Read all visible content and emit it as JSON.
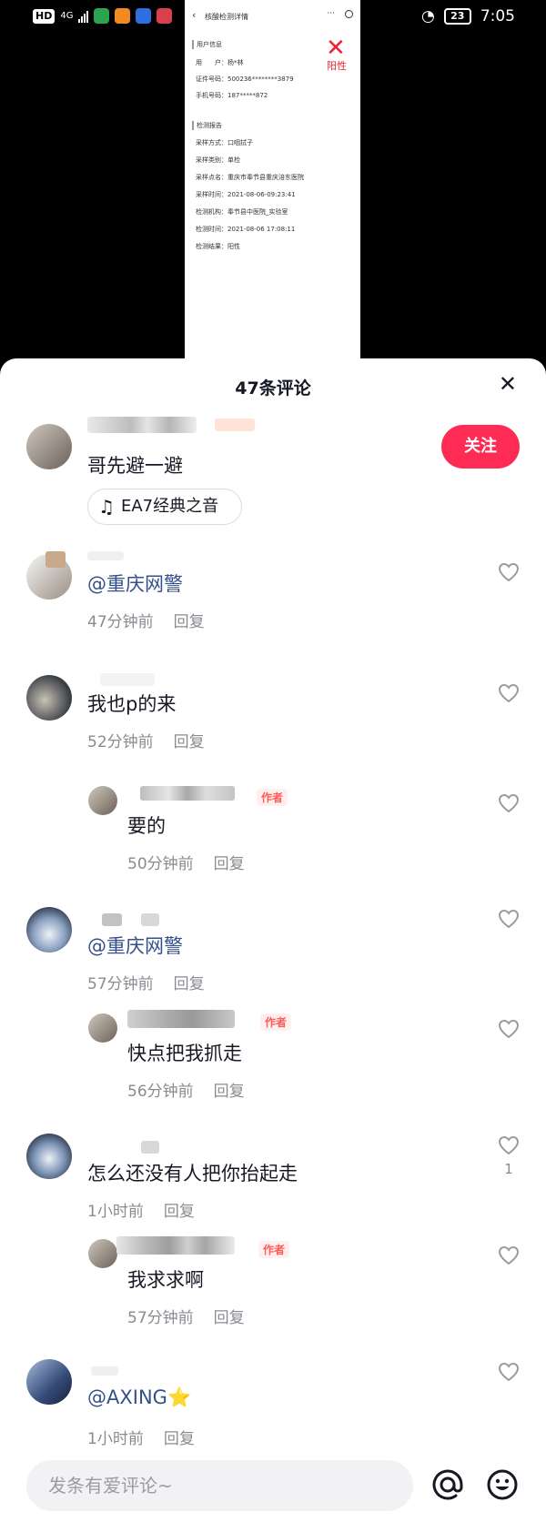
{
  "status_bar": {
    "hd": "HD",
    "network": "4G",
    "time": "7:05",
    "battery": "23"
  },
  "video": {
    "nav_title": "核酸检测详情",
    "nav_more": "···",
    "section_user": "用户信息",
    "rows_user": [
      "用　　户：杨*林",
      "证件号码：500236********3879",
      "手机号码：187*****872"
    ],
    "section_report": "检测报告",
    "rows_report": [
      "采样方式：口咽拭子",
      "采样类别：单检",
      "采样点名：重庆市奉节县重庆涪东医院",
      "采样时间：2021-08-06-09:23:41",
      "检测机构：奉节县中医院_实验室",
      "检测时间：2021-08-06 17:08:11",
      "检测结果：阳性"
    ],
    "result_mark": "✕",
    "result_label": "阳性"
  },
  "panel": {
    "title": "47条评论",
    "close_icon": "close-icon",
    "follow_label": "关注",
    "input_placeholder": "发条有爱评论~",
    "author_badge": "作者",
    "reply_label": "回复"
  },
  "comments": [
    {
      "text": "哥先避一避",
      "music": "EA7经典之音"
    },
    {
      "text": "@重庆网警",
      "time": "47分钟前",
      "reply": "回复"
    },
    {
      "text": "我也p的来",
      "time": "52分钟前",
      "reply": "回复"
    },
    {
      "text": "要的",
      "time": "50分钟前",
      "reply": "回复",
      "badge": "作者"
    },
    {
      "text": "@重庆网警",
      "time": "57分钟前",
      "reply": "回复"
    },
    {
      "text": "快点把我抓走",
      "time": "56分钟前",
      "reply": "回复",
      "badge": "作者"
    },
    {
      "text": "怎么还没有人把你抬起走",
      "time": "1小时前",
      "reply": "回复",
      "likes": "1"
    },
    {
      "text": "我求求啊",
      "time": "57分钟前",
      "reply": "回复",
      "badge": "作者"
    },
    {
      "text": "@AXING",
      "emoji": "⭐",
      "time": "1小时前",
      "reply": "回复"
    }
  ]
}
